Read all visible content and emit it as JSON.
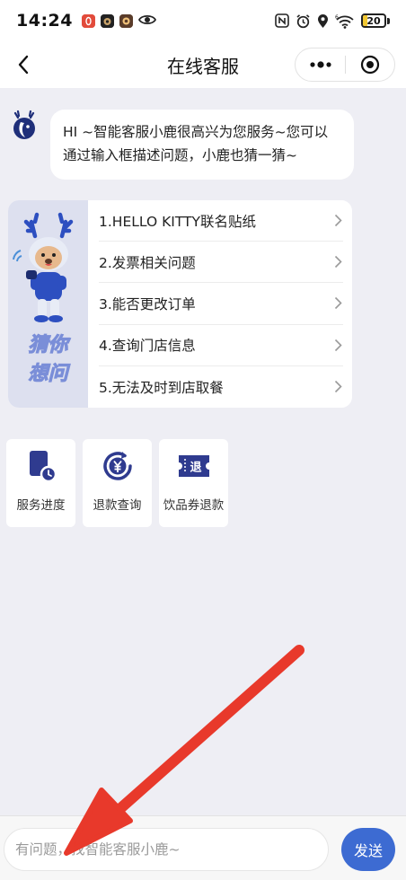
{
  "status_bar": {
    "time": "14:24",
    "battery_level": "20",
    "battery_fraction": 0.2,
    "left_icons": [
      "app-notification-icon",
      "app-icon-black",
      "app-icon-brown",
      "eye-icon"
    ],
    "right_icons": [
      "nfc-icon",
      "alarm-icon",
      "location-icon",
      "wifi-6-icon",
      "battery-icon"
    ]
  },
  "nav": {
    "title": "在线客服",
    "back_icon": "chevron-left-icon",
    "more_icon": "more-dots-icon",
    "close_icon": "target-close-icon"
  },
  "chat": {
    "greeting": "HI ~智能客服小鹿很高兴为您服务~您可以通过输入框描述问题，小鹿也猜一猜~"
  },
  "guess": {
    "banner_text": [
      "猜你",
      "想问"
    ],
    "items": [
      {
        "label": "1.HELLO KITTY联名贴纸"
      },
      {
        "label": "2.发票相关问题"
      },
      {
        "label": "3.能否更改订单"
      },
      {
        "label": "4.查询门店信息"
      },
      {
        "label": "5.无法及时到店取餐"
      }
    ]
  },
  "quick_tiles": [
    {
      "label": "服务进度",
      "icon": "service-progress-icon"
    },
    {
      "label": "退款查询",
      "icon": "refund-query-icon"
    },
    {
      "label": "饮品券退款",
      "icon": "voucher-refund-icon"
    }
  ],
  "input": {
    "placeholder": "有问题，找智能客服小鹿~",
    "send_label": "发送"
  },
  "colors": {
    "brand_blue": "#3d6bd2",
    "tile_icon_navy": "#2f3b8f",
    "background": "#eeeef4",
    "annotation_red": "#e8392b"
  }
}
